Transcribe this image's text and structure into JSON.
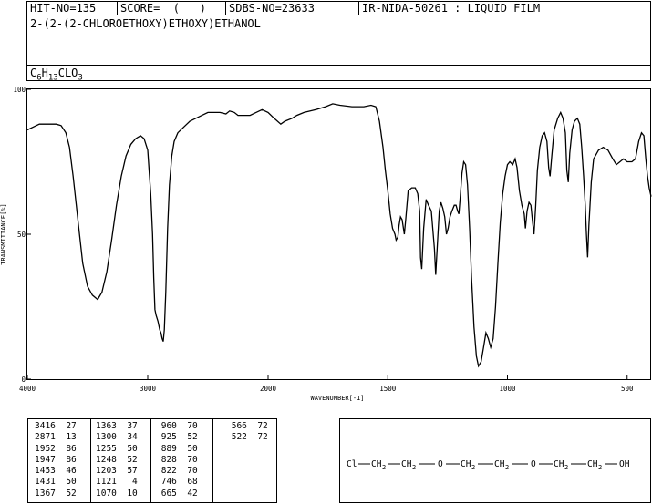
{
  "header": {
    "hit_no": "HIT-NO=135",
    "score": "SCORE=  (   )",
    "sdbs_no": "SDBS-NO=23633",
    "ir_info": "IR-NIDA-50261 : LIQUID FILM",
    "compound_name": "2-(2-(2-CHLOROETHOXY)ETHOXY)ETHANOL",
    "formula": {
      "c": "C",
      "c_sub": "6",
      "h": "H",
      "h_sub": "13",
      "rest": "CLO",
      "o_sub": "3"
    }
  },
  "chart_data": {
    "type": "line",
    "xlabel": "WAVENUMBER[-1]",
    "ylabel": "TRANSMITTANCE[%]",
    "xlim": [
      4000,
      400
    ],
    "ylim": [
      0,
      100
    ],
    "x_ticks": [
      4000,
      3000,
      2000,
      1500,
      1000,
      500
    ],
    "y_ticks": [
      0,
      50,
      100
    ],
    "x_tick_labels": [
      "4000",
      "3000",
      "2000",
      "1500",
      "1000",
      "500"
    ],
    "y_tick_labels": [
      "0",
      "50",
      "100"
    ],
    "grid": false,
    "series": [
      {
        "color": "#000000",
        "points": [
          [
            4000,
            86
          ],
          [
            3950,
            87
          ],
          [
            3900,
            88
          ],
          [
            3850,
            88
          ],
          [
            3800,
            88
          ],
          [
            3760,
            88
          ],
          [
            3720,
            87.5
          ],
          [
            3680,
            85
          ],
          [
            3650,
            80
          ],
          [
            3620,
            70
          ],
          [
            3580,
            55
          ],
          [
            3540,
            40
          ],
          [
            3500,
            32
          ],
          [
            3460,
            29
          ],
          [
            3416,
            27.5
          ],
          [
            3380,
            30
          ],
          [
            3340,
            37
          ],
          [
            3300,
            48
          ],
          [
            3260,
            60
          ],
          [
            3220,
            70
          ],
          [
            3180,
            77
          ],
          [
            3140,
            81
          ],
          [
            3100,
            83
          ],
          [
            3060,
            84
          ],
          [
            3030,
            83
          ],
          [
            3000,
            79
          ],
          [
            2990,
            73
          ],
          [
            2975,
            64
          ],
          [
            2960,
            50
          ],
          [
            2950,
            35
          ],
          [
            2940,
            24
          ],
          [
            2930,
            22
          ],
          [
            2915,
            20
          ],
          [
            2900,
            17
          ],
          [
            2890,
            16
          ],
          [
            2880,
            14
          ],
          [
            2871,
            13
          ],
          [
            2862,
            17
          ],
          [
            2850,
            30
          ],
          [
            2835,
            52
          ],
          [
            2820,
            67
          ],
          [
            2800,
            77
          ],
          [
            2780,
            82
          ],
          [
            2750,
            85
          ],
          [
            2700,
            87
          ],
          [
            2650,
            89
          ],
          [
            2600,
            90
          ],
          [
            2550,
            91
          ],
          [
            2500,
            92
          ],
          [
            2450,
            92
          ],
          [
            2400,
            92
          ],
          [
            2350,
            91.5
          ],
          [
            2320,
            92.5
          ],
          [
            2280,
            92
          ],
          [
            2250,
            91
          ],
          [
            2200,
            91
          ],
          [
            2150,
            91
          ],
          [
            2100,
            92
          ],
          [
            2050,
            93
          ],
          [
            2000,
            92
          ],
          [
            1975,
            90
          ],
          [
            1947,
            88
          ],
          [
            1930,
            89
          ],
          [
            1900,
            90
          ],
          [
            1880,
            91
          ],
          [
            1850,
            92
          ],
          [
            1800,
            93
          ],
          [
            1760,
            94
          ],
          [
            1730,
            95
          ],
          [
            1700,
            94.5
          ],
          [
            1650,
            94
          ],
          [
            1600,
            94
          ],
          [
            1570,
            94.5
          ],
          [
            1550,
            94
          ],
          [
            1535,
            89
          ],
          [
            1520,
            80
          ],
          [
            1510,
            72
          ],
          [
            1500,
            65
          ],
          [
            1490,
            57
          ],
          [
            1480,
            52
          ],
          [
            1470,
            50
          ],
          [
            1465,
            48
          ],
          [
            1458,
            49
          ],
          [
            1453,
            53
          ],
          [
            1447,
            56
          ],
          [
            1440,
            55
          ],
          [
            1431,
            50
          ],
          [
            1425,
            55
          ],
          [
            1415,
            65
          ],
          [
            1400,
            66
          ],
          [
            1385,
            66
          ],
          [
            1375,
            64
          ],
          [
            1367,
            58
          ],
          [
            1363,
            42
          ],
          [
            1358,
            38
          ],
          [
            1350,
            52
          ],
          [
            1340,
            62
          ],
          [
            1330,
            60
          ],
          [
            1318,
            58
          ],
          [
            1305,
            45
          ],
          [
            1300,
            36
          ],
          [
            1292,
            48
          ],
          [
            1285,
            58
          ],
          [
            1278,
            61
          ],
          [
            1270,
            59
          ],
          [
            1262,
            56
          ],
          [
            1255,
            50
          ],
          [
            1248,
            52
          ],
          [
            1240,
            56
          ],
          [
            1232,
            58
          ],
          [
            1222,
            60
          ],
          [
            1215,
            60
          ],
          [
            1208,
            58
          ],
          [
            1203,
            57
          ],
          [
            1198,
            62
          ],
          [
            1190,
            71
          ],
          [
            1183,
            75
          ],
          [
            1175,
            74
          ],
          [
            1167,
            67
          ],
          [
            1158,
            52
          ],
          [
            1150,
            35
          ],
          [
            1140,
            18
          ],
          [
            1130,
            8
          ],
          [
            1121,
            4.5
          ],
          [
            1110,
            6
          ],
          [
            1100,
            11
          ],
          [
            1090,
            16
          ],
          [
            1080,
            14
          ],
          [
            1070,
            11
          ],
          [
            1060,
            14
          ],
          [
            1050,
            25
          ],
          [
            1040,
            40
          ],
          [
            1030,
            54
          ],
          [
            1020,
            64
          ],
          [
            1010,
            70
          ],
          [
            1000,
            74
          ],
          [
            990,
            75
          ],
          [
            978,
            74
          ],
          [
            968,
            76
          ],
          [
            960,
            73
          ],
          [
            950,
            65
          ],
          [
            940,
            60
          ],
          [
            930,
            57
          ],
          [
            925,
            52
          ],
          [
            918,
            58
          ],
          [
            910,
            61
          ],
          [
            902,
            60
          ],
          [
            895,
            54
          ],
          [
            889,
            50
          ],
          [
            882,
            60
          ],
          [
            875,
            72
          ],
          [
            865,
            80
          ],
          [
            855,
            84
          ],
          [
            845,
            85
          ],
          [
            835,
            82
          ],
          [
            828,
            73
          ],
          [
            822,
            70
          ],
          [
            815,
            77
          ],
          [
            805,
            86
          ],
          [
            790,
            90
          ],
          [
            778,
            92
          ],
          [
            768,
            90
          ],
          [
            758,
            85
          ],
          [
            752,
            72
          ],
          [
            746,
            68
          ],
          [
            740,
            78
          ],
          [
            730,
            86
          ],
          [
            720,
            89
          ],
          [
            708,
            90
          ],
          [
            698,
            88
          ],
          [
            690,
            80
          ],
          [
            682,
            70
          ],
          [
            675,
            60
          ],
          [
            670,
            50
          ],
          [
            665,
            42
          ],
          [
            660,
            53
          ],
          [
            650,
            68
          ],
          [
            640,
            76
          ],
          [
            620,
            79
          ],
          [
            600,
            80
          ],
          [
            580,
            79
          ],
          [
            560,
            76
          ],
          [
            545,
            74
          ],
          [
            530,
            75
          ],
          [
            515,
            76
          ],
          [
            500,
            75
          ],
          [
            480,
            75
          ],
          [
            465,
            76
          ],
          [
            452,
            82
          ],
          [
            440,
            85
          ],
          [
            430,
            84
          ],
          [
            422,
            76
          ],
          [
            415,
            70
          ],
          [
            408,
            66
          ],
          [
            400,
            63
          ]
        ]
      }
    ]
  },
  "peak_table": {
    "columns": [
      [
        [
          "3416",
          "27"
        ],
        [
          "2871",
          "13"
        ],
        [
          "1952",
          "86"
        ],
        [
          "1947",
          "86"
        ],
        [
          "1453",
          "46"
        ],
        [
          "1431",
          "50"
        ],
        [
          "1367",
          "52"
        ]
      ],
      [
        [
          "1363",
          "37"
        ],
        [
          "1300",
          "34"
        ],
        [
          "1255",
          "50"
        ],
        [
          "1248",
          "52"
        ],
        [
          "1203",
          "57"
        ],
        [
          "1121",
          "4"
        ],
        [
          "1070",
          "10"
        ]
      ],
      [
        [
          "960",
          "70"
        ],
        [
          "925",
          "52"
        ],
        [
          "889",
          "50"
        ],
        [
          "828",
          "70"
        ],
        [
          "822",
          "70"
        ],
        [
          "746",
          "68"
        ],
        [
          "665",
          "42"
        ]
      ],
      [
        [
          "566",
          "72"
        ],
        [
          "522",
          "72"
        ]
      ]
    ]
  },
  "structure": {
    "cl": "Cl",
    "ch": "CH",
    "sub2": "2",
    "o": "O",
    "oh": "OH"
  }
}
